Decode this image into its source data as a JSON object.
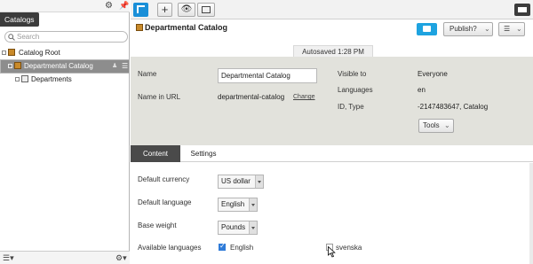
{
  "left_panel": {
    "tab_label": "Catalogs",
    "search_placeholder": "Search",
    "tree": [
      {
        "label": "Catalog Root"
      },
      {
        "label": "Departmental Catalog"
      },
      {
        "label": "Departments"
      }
    ]
  },
  "header": {
    "title": "Departmental Catalog",
    "publish_label": "Publish?",
    "autosaved": "Autosaved 1:28 PM"
  },
  "properties": {
    "name_label": "Name",
    "name_value": "Departmental Catalog",
    "url_label": "Name in URL",
    "url_value": "departmental-catalog",
    "change_link": "Change",
    "visible_label": "Visible to",
    "visible_value": "Everyone",
    "languages_label": "Languages",
    "languages_value": "en",
    "id_label": "ID, Type",
    "id_value": "-2147483647, Catalog",
    "tools_label": "Tools"
  },
  "tabs": [
    "Content",
    "Settings"
  ],
  "content": {
    "currency_label": "Default currency",
    "currency_value": "US dollar",
    "language_label": "Default language",
    "language_value": "English",
    "weight_label": "Base weight",
    "weight_value": "Pounds",
    "available_label": "Available languages",
    "lang_english": "English",
    "lang_svenska": "svenska"
  },
  "colors": {
    "accent": "#1ea3e0",
    "tab_active": "#4a4a4a"
  }
}
